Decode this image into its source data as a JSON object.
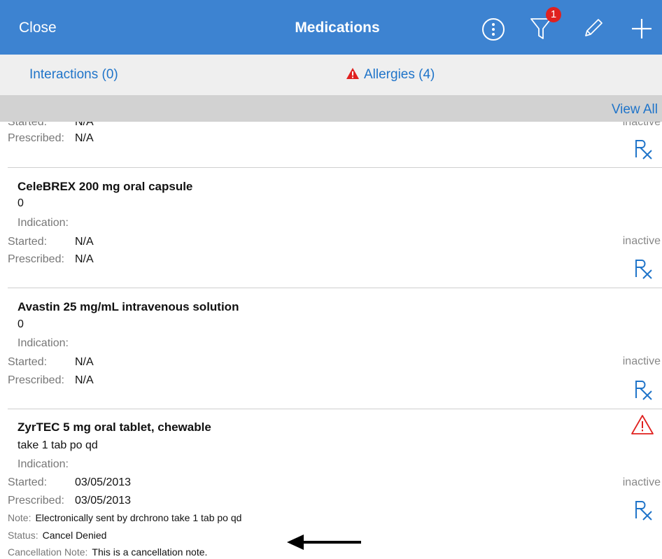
{
  "nav": {
    "close_label": "Close",
    "title": "Medications",
    "filter_badge": "1",
    "icons": [
      "info-icon",
      "filter-icon",
      "pencil-icon",
      "plus-icon"
    ]
  },
  "tabs": {
    "interactions": "Interactions (0)",
    "allergies": "Allergies (4)"
  },
  "view_all": "View All",
  "labels": {
    "started": "Started:",
    "prescribed": "Prescribed:",
    "indication": "Indication:",
    "inactive": "inactive",
    "note": "Note:",
    "status": "Status:",
    "cancellation_note": "Cancellation Note:"
  },
  "partial": {
    "started_text": "Started:",
    "started_value": "N/A",
    "inactive_text": "inactive",
    "prescribed_value": "N/A"
  },
  "medications": [
    {
      "name": "CeleBREX 200 mg oral capsule",
      "instructions": "0",
      "started": "N/A",
      "prescribed": "N/A",
      "status_tag": "inactive"
    },
    {
      "name": "Avastin 25 mg/mL intravenous solution",
      "instructions": "0",
      "started": "N/A",
      "prescribed": "N/A",
      "status_tag": "inactive"
    },
    {
      "name": "ZyrTEC 5 mg oral tablet, chewable",
      "instructions": "take 1 tab po qd",
      "started": "03/05/2013",
      "prescribed": "03/05/2013",
      "status_tag": "inactive",
      "note": "Electronically sent by drchrono take 1 tab po qd",
      "status": "Cancel Denied",
      "cancellation_note": "This is a cancellation note."
    }
  ],
  "colors": {
    "nav_bg": "#3d83d1",
    "link": "#1f74c9",
    "alert": "#e0211f"
  }
}
